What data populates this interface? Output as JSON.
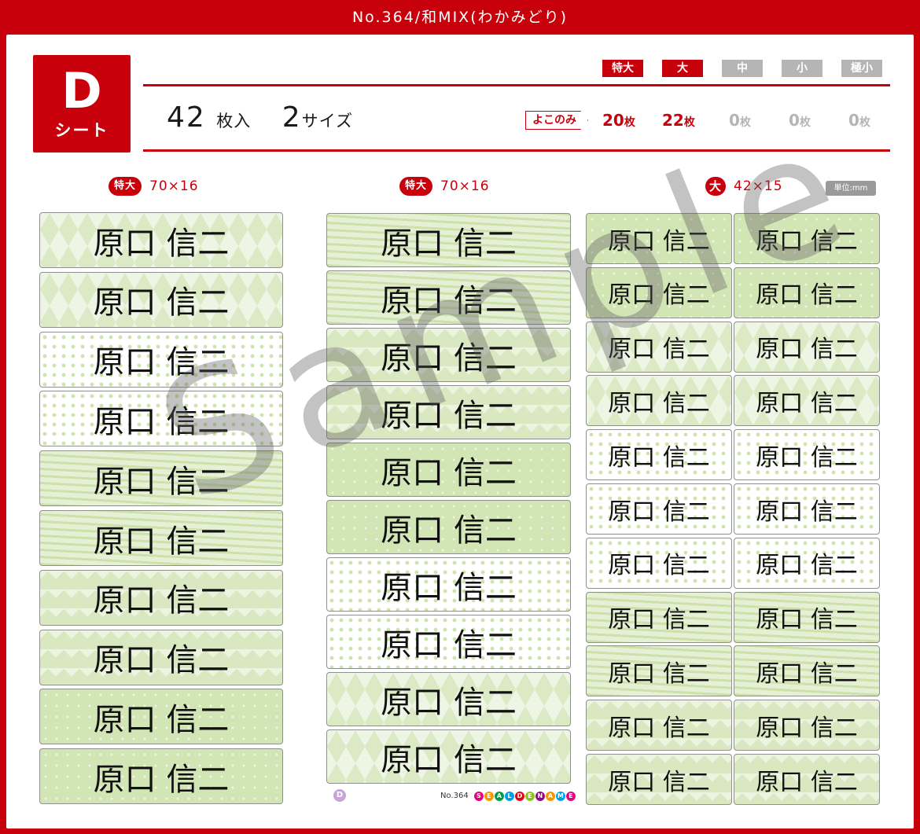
{
  "title": "No.364/和MIX(わかみどり)",
  "sheet": {
    "letter": "D",
    "word": "シート"
  },
  "count": {
    "num": "42",
    "unit": "枚入",
    "sizes": "2",
    "sizes_unit": "サイズ"
  },
  "size_tabs": [
    {
      "label": "特大",
      "active": true
    },
    {
      "label": "大",
      "active": true
    },
    {
      "label": "中",
      "active": false
    },
    {
      "label": "小",
      "active": false
    },
    {
      "label": "極小",
      "active": false
    }
  ],
  "yoko_label": "よこのみ",
  "quantities": [
    {
      "n": "20",
      "u": "枚"
    },
    {
      "n": "22",
      "u": "枚"
    },
    {
      "n": "0",
      "u": "枚"
    },
    {
      "n": "0",
      "u": "枚"
    },
    {
      "n": "0",
      "u": "枚"
    }
  ],
  "columns": [
    {
      "badge": "特大",
      "dims": "70×16"
    },
    {
      "badge": "特大",
      "dims": "70×16"
    },
    {
      "badge": "大",
      "dims": "42×15"
    }
  ],
  "unit_note": "単位:mm",
  "label_name": "原口 信二",
  "watermark": "Sample",
  "footer": {
    "badge": "D",
    "number": "No.364",
    "brand": "SEALDENAME"
  },
  "colors": {
    "brand_red": "#c8000b",
    "inactive_gray": "#b5b5b5",
    "label_green": "#d2e5b4"
  }
}
